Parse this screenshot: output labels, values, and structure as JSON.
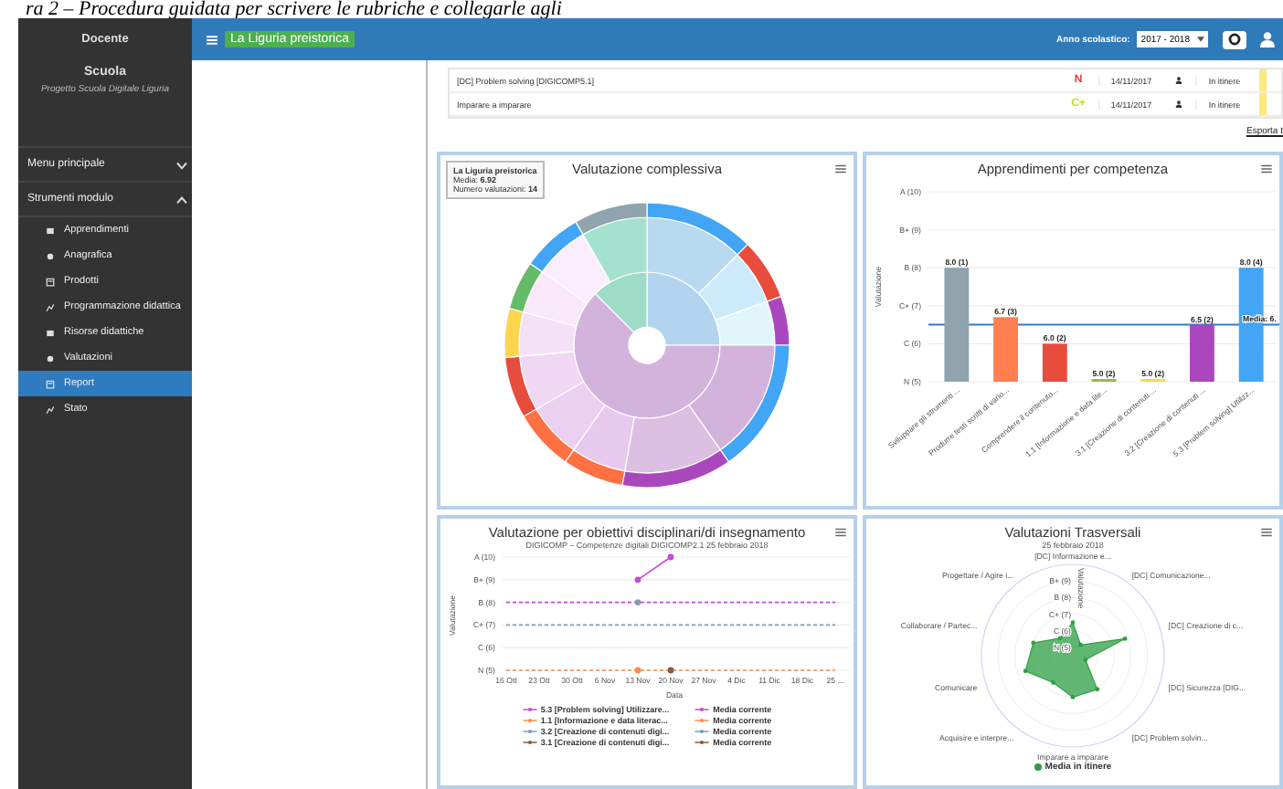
{
  "caption": "ra 2 – Procedura guidata per scrivere le rubriche e collegarle agli",
  "sidebar": {
    "role": "Docente",
    "school": "Scuola",
    "project": "Progetto Scuola Digitale Liguria",
    "sections": [
      {
        "label": "Menu principale",
        "expanded": false
      },
      {
        "label": "Strumenti modulo",
        "expanded": true
      }
    ],
    "items": [
      {
        "label": "Apprendimenti",
        "selected": false
      },
      {
        "label": "Anagrafica",
        "selected": false
      },
      {
        "label": "Prodotti",
        "selected": false
      },
      {
        "label": "Programmazione didattica",
        "selected": false
      },
      {
        "label": "Risorse didattiche",
        "selected": false
      },
      {
        "label": "Valutazioni",
        "selected": false
      },
      {
        "label": "Report",
        "selected": true
      },
      {
        "label": "Stato",
        "selected": false
      }
    ]
  },
  "topbar": {
    "module": "La Liguria preistorica",
    "year_label": "Anno scolastico:",
    "year_value": "2017 - 2018"
  },
  "table": {
    "rows": [
      {
        "competence": "[DC] Problem solving [DIGICOMP5.1]",
        "grade": "N",
        "color": "#e53935",
        "date": "14/11/2017",
        "status": "In itinere"
      },
      {
        "competence": "Imparare a imparare",
        "grade": "C+",
        "color": "#c6d92e",
        "date": "14/11/2017",
        "status": "In itinere"
      }
    ],
    "export_link": "Esporta t"
  },
  "overall": {
    "title": "Valutazione complessiva",
    "tooltip": {
      "title": "La Liguria preistorica",
      "lines": [
        "Media: **6.92**",
        "Numero valutazioni: **14**"
      ]
    }
  },
  "competence_chart": {
    "chart_data": {
      "type": "bar",
      "title": "Apprendimenti per competenza",
      "ylabel": "Valutazione",
      "categories": [
        "Sviluppare gli strumenti ...",
        "Produrre testi scritti di vario...",
        "Comprendere il contenuto...",
        "1.1 [Informazione e data lite...",
        "3.1 [Creazione di contenuti ...",
        "3.2 [Creazione di contenuti ...",
        "5.3 [Problem solving] Utilizz..."
      ],
      "series": [
        {
          "values": [
            8.0,
            6.7,
            6.0,
            5.0,
            5.0,
            6.5,
            8.0
          ],
          "colors": [
            "#90a4ae",
            "#ff7f50",
            "#e84c3d",
            "#8bc34a",
            "#ffd54f",
            "#ab47bc",
            "#42a5f5"
          ]
        }
      ],
      "ylim": [
        5,
        10
      ],
      "grid": true,
      "yticks": [
        {
          "value": 5,
          "label": "N (5)"
        },
        {
          "value": 6,
          "label": "C (6)"
        },
        {
          "value": 7,
          "label": "C+ (7)"
        },
        {
          "value": 8,
          "label": "B (8)"
        },
        {
          "value": 9,
          "label": "B+ (9)"
        },
        {
          "value": 10,
          "label": "A (10)"
        }
      ],
      "value_labels": [
        "8.0 (1)",
        "6.7 (3)",
        "6.0 (2)",
        "5.0 (2)",
        "5.0 (2)",
        "6.5 (2)",
        "8.0 (4)"
      ],
      "ref_lines": [
        {
          "axis": "y",
          "value": 6.5,
          "label": "Media: 6.",
          "color": "#3a78c2"
        }
      ]
    }
  },
  "objectives_chart": {
    "subtitle": "DIGICOMP – Competenze digitali DIGICOMP2.1 25 febbraio 2018",
    "chart_data": {
      "type": "line",
      "title": "Valutazione per obiettivi disciplinari/di insegnamento",
      "xlabel": "Data",
      "ylabel": "Valutazione",
      "categories": [
        "16 Ott",
        "23 Ott",
        "30 Ott",
        "6 Nov",
        "13 Nov",
        "20 Nov",
        "27 Nov",
        "4 Dic",
        "11 Dic",
        "18 Dic",
        "25 ..."
      ],
      "ylim": [
        5,
        10
      ],
      "grid": true,
      "yticks": [
        {
          "value": 5,
          "label": "N (5)"
        },
        {
          "value": 6,
          "label": "C (6)"
        },
        {
          "value": 7,
          "label": "C+ (7)"
        },
        {
          "value": 8,
          "label": "B (8)"
        },
        {
          "value": 9,
          "label": "B+ (9)"
        },
        {
          "value": 10,
          "label": "A (10)"
        }
      ],
      "series": [
        {
          "name": "5.3 [Problem solving] Utilizzare...",
          "color": "#c64ad6",
          "line_style": "solid",
          "marker": "circle",
          "values": [
            null,
            null,
            null,
            null,
            9,
            10,
            null,
            null,
            null,
            null,
            null
          ]
        },
        {
          "name": "1.1 [Informazione e data literac...",
          "color": "#ff8c42",
          "line_style": "solid",
          "marker": "circle",
          "values": [
            null,
            null,
            null,
            null,
            5,
            null,
            null,
            null,
            null,
            null,
            null
          ]
        },
        {
          "name": "3.2 [Creazione di contenuti digi...",
          "color": "#7f9cb0",
          "line_style": "solid",
          "marker": "circle",
          "values": [
            null,
            null,
            null,
            null,
            8,
            null,
            null,
            null,
            null,
            null,
            null
          ]
        },
        {
          "name": "3.1 [Creazione di contenuti digi...",
          "color": "#8d5a3c",
          "line_style": "solid",
          "marker": "circle",
          "values": [
            null,
            null,
            null,
            null,
            null,
            5,
            null,
            null,
            null,
            null,
            null
          ]
        },
        {
          "name": "Media corrente",
          "color": "#c64ad6",
          "line_style": "dashed",
          "marker": "none",
          "values": [
            8,
            8,
            8,
            8,
            8,
            8,
            8,
            8,
            8,
            8,
            8
          ]
        },
        {
          "name": "Media corrente",
          "color": "#ff8c42",
          "line_style": "dashed",
          "marker": "none",
          "values": [
            5,
            5,
            5,
            5,
            5,
            5,
            5,
            5,
            5,
            5,
            5
          ]
        },
        {
          "name": "Media corrente",
          "color": "#7f9cb0",
          "line_style": "dashed",
          "marker": "none",
          "values": [
            7,
            7,
            7,
            7,
            7,
            7,
            7,
            7,
            7,
            7,
            7
          ]
        },
        {
          "name": "Media corrente",
          "color": "#8d5a3c",
          "values": [
            null,
            null,
            null,
            null,
            null,
            null,
            null,
            null,
            null,
            null,
            null
          ]
        }
      ]
    }
  },
  "transversal_chart": {
    "title": "Valutazioni Trasversali",
    "subtitle": "25 febbraio 2018",
    "axis_title": "Valutazione",
    "axes": [
      "[DC] Informazione e...",
      "Progettare / Agire i...",
      "[DC] Comunicazione...",
      "Collaborare / Partec...",
      "[DC] Creazione di c...",
      "Comunicare",
      "[DC] Sicurezza [DIG...",
      "Acquisire e interpre...",
      "[DC] Problem solvin...",
      "Imparare a imparare"
    ],
    "ticks": [
      "B+ (9)",
      "B (8)",
      "C+ (7)",
      "C (6)",
      "N (5)"
    ],
    "legend": [
      {
        "name": "Media in itinere",
        "color": "#2e9e44"
      }
    ]
  }
}
